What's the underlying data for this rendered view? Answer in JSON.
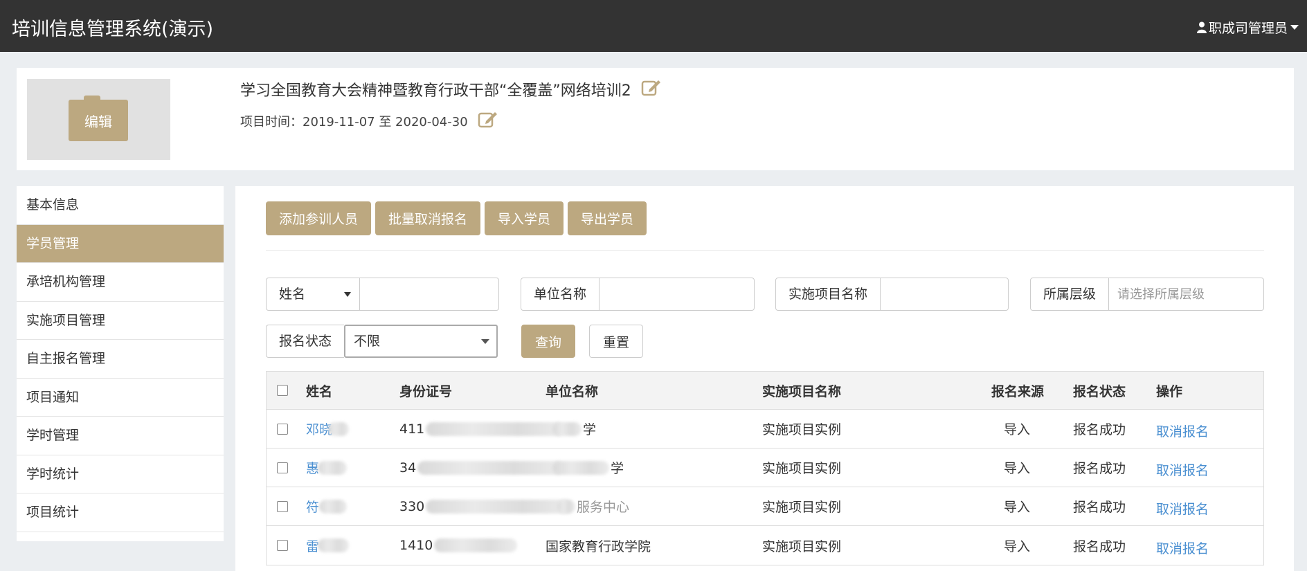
{
  "app": {
    "title": "培训信息管理系统(演示)",
    "user": "职成司管理员"
  },
  "project": {
    "edit_thumb_label": "编辑",
    "title": "学习全国教育大会精神暨教育行政干部“全覆盖”网络培训2",
    "time": "项目时间：2019-11-07 至 2020-04-30"
  },
  "sidebar": {
    "items": [
      {
        "label": "基本信息"
      },
      {
        "label": "学员管理"
      },
      {
        "label": "承培机构管理"
      },
      {
        "label": "实施项目管理"
      },
      {
        "label": "自主报名管理"
      },
      {
        "label": "项目通知"
      },
      {
        "label": "学时管理"
      },
      {
        "label": "学时统计"
      },
      {
        "label": "项目统计"
      }
    ]
  },
  "toolbar": {
    "add": "添加参训人员",
    "batch_cancel": "批量取消报名",
    "import": "导入学员",
    "export": "导出学员"
  },
  "filters": {
    "name_select": "姓名",
    "unit_label": "单位名称",
    "project_label": "实施项目名称",
    "level_label": "所属层级",
    "level_placeholder": "请选择所属层级",
    "status_label": "报名状态",
    "status_value": "不限",
    "query": "查询",
    "reset": "重置"
  },
  "table": {
    "headers": [
      "姓名",
      "身份证号",
      "单位名称",
      "实施项目名称",
      "报名来源",
      "报名状态",
      "操作"
    ],
    "rows": [
      {
        "name": "邓晓",
        "id": "411",
        "unit": "学",
        "project": "实施项目实例",
        "source": "导入",
        "status": "报名成功",
        "action": "取消报名"
      },
      {
        "name": "惠",
        "id": "34",
        "unit": "学",
        "project": "实施项目实例",
        "source": "导入",
        "status": "报名成功",
        "action": "取消报名"
      },
      {
        "name": "符",
        "id": "330",
        "unit": "服务中心",
        "project": "实施项目实例",
        "source": "导入",
        "status": "报名成功",
        "action": "取消报名"
      },
      {
        "name": "雷",
        "id": "1410",
        "unit": "国家教育行政学院",
        "project": "实施项目实例",
        "source": "导入",
        "status": "报名成功",
        "action": "取消报名"
      }
    ]
  },
  "colors": {
    "accent": "#bca880",
    "topbar": "#333333",
    "link": "#4a8fd1"
  }
}
